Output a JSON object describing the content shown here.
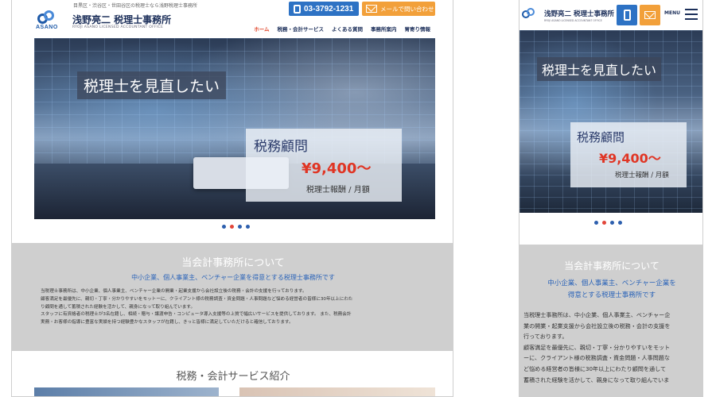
{
  "desktop": {
    "tagline": "目黒区・渋谷区・世田谷区の税理士なら浅野税理士事務所",
    "logo_word": "ASANO",
    "brand": "浅野亮二 税理士事務所",
    "brand_sub": "RYOJI ASANO LICENSED ACCOUNTANT OFFICE",
    "phone": "03-3792-1231",
    "mail": "メールで問い合わせ",
    "nav": [
      "ホーム",
      "税務・会計サービス",
      "よくある質問",
      "事務所案内",
      "胃寄り情報"
    ],
    "hero": {
      "headline": "税理士を見直したい",
      "card_title": "税務顧問",
      "price": "¥9,400～",
      "price_note": "税理士報酬 / 月額"
    },
    "about": {
      "title": "当会計事務所について",
      "subtitle": "中小企業、個人事業主、ベンチャー企業を得意とする税理士事務所です",
      "lines": [
        "当税理士事務所は、中小企業、個人事業主、ベンチャー企業の開業・起業支援から会社設立後の税務・会計の支援を行っております。",
        "顧客満足を最優先に、親切・丁寧・分かりやすいをモットーに、クライアント様の税務調査・資金問題・人事問題など悩める経営者の皆様に30年以上にわた",
        "り顧問を通して蓄積された経験を活かして、親身になって取り組んでいます。",
        "スタッフに有資格者の税理士が3名在籍し、相続・贈与・譲渡申告・コンピュータ導入支援等の上質で幅広いサービスを提供しております。 また、税務会計",
        "実務・お客様の指導に豊富な実績を持つ経験豊かなスタッフが在籍し、きっと皆様に満足していただけると確信しております。"
      ]
    },
    "services_title": "税務・会計サービス紹介"
  },
  "mobile": {
    "brand": "浅野亮二 税理士事務所",
    "brand_sub": "RYOJI ASANO LICENSED ACCOUNTANT OFFICE",
    "menu": "MENU",
    "hero": {
      "headline": "税理士を見直したい",
      "card_title": "税務顧問",
      "price": "¥9,400～",
      "price_note": "税理士報酬 / 月額"
    },
    "about": {
      "title": "当会計事務所について",
      "subtitle_lines": [
        "中小企業、個人事業主、ベンチャー企業を",
        "得意とする税理士事務所です"
      ],
      "lines": [
        "当税理士事務所は、中小企業、個人事業主、ベンチャー企",
        "業の開業・起業支援から会社設立後の税務・会計の支援を",
        "行っております。",
        "顧客満足を最優先に、親切・丁寧・分かりやすいをモット",
        "ーに、クライアント様の税務調査・資金問題・人事問題な",
        "ど悩める経営者の皆様に30年以上にわたり顧問を通して",
        "蓄積された経験を活かして、親身になって取り組んでいま"
      ]
    }
  },
  "colors": {
    "navy": "#1c2f5a",
    "blue": "#2d72c4",
    "orange": "#f2a03a",
    "red": "#e03524",
    "gray": "#cfcfcf"
  }
}
